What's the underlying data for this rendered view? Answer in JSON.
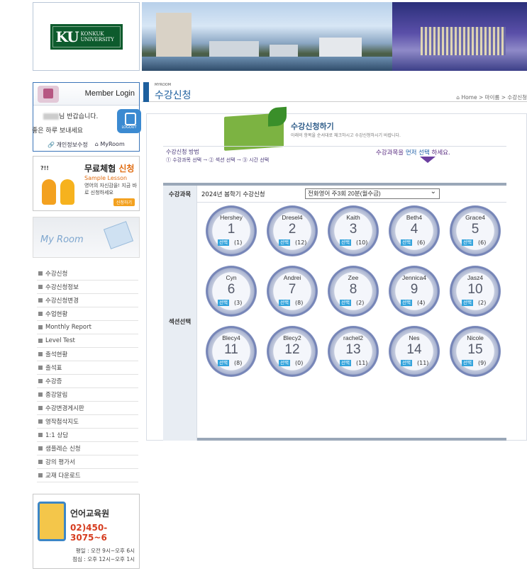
{
  "header": {
    "logo_mark": "KU",
    "logo_name_1": "KONKUK",
    "logo_name_2": "UNIVERSITY"
  },
  "login": {
    "title": "Member Login",
    "welcome_suffix": "님 반갑습니다.",
    "greeting": "좋은 하루 보내세요",
    "logout_label": "LOGOUT",
    "link_privacy": "개인정보수정",
    "link_myroom": "MyRoom"
  },
  "trial": {
    "title_plain": "무료체험",
    "title_highlight": "신청",
    "subtitle": "Sample Lesson",
    "desc": "영어의 자신감을! 지금 바로 신청하세요",
    "button": "신청하기",
    "badge": "?!!"
  },
  "myroom": {
    "title": "My Room"
  },
  "menu": [
    "수강신청",
    "수강신청정보",
    "수강신청변경",
    "수업현황",
    "Monthly Report",
    "Level Test",
    "출석현황",
    "출석표",
    "수강증",
    "종강알림",
    "수강변경게시판",
    "영작첨삭지도",
    "1:1 상담",
    "샘플레슨 신청",
    "강의 평가서",
    "교재 다운로드"
  ],
  "lang_center": {
    "title": "언어교육원",
    "phone": "02)450-3075~6",
    "hours_weekday": "평일 : 오전 9시~오후 6시",
    "hours_lunch": "점심 : 오후 12시~오후 1시"
  },
  "page": {
    "small_label": "MYROOM",
    "title": "수강신청",
    "breadcrumb": "⌂ Home > 마이룸 > 수강신청"
  },
  "enroll_header": {
    "title": "수강신청하기",
    "subtitle": "아래의 항목을 순서대로 체크하시고 수강신청하시기 바랍니다."
  },
  "howto": {
    "title": "수강신청 방법",
    "steps": "① 수강과목 선택 → ② 섹션 선택 → ③ 시간 선택",
    "notice_pre": "수강과목",
    "notice_mid": "을 ",
    "notice_blue": "먼저 선택",
    "notice_post": " 하세요."
  },
  "form": {
    "course_label": "수강과목",
    "course_text": "2024년 봄학기 수강신청",
    "course_selected": "전화영어 주3회 20분(월수금)",
    "section_label": "섹션선택"
  },
  "select_label": "선택",
  "tutors": [
    {
      "name": "Hershey",
      "num": "1",
      "count": "(1)"
    },
    {
      "name": "Dresel4",
      "num": "2",
      "count": "(12)"
    },
    {
      "name": "Kaith",
      "num": "3",
      "count": "(10)"
    },
    {
      "name": "Beth4",
      "num": "4",
      "count": "(6)"
    },
    {
      "name": "Grace4",
      "num": "5",
      "count": "(6)"
    },
    {
      "name": "Cyn",
      "num": "6",
      "count": "(3)"
    },
    {
      "name": "Andrei",
      "num": "7",
      "count": "(8)"
    },
    {
      "name": "Zee",
      "num": "8",
      "count": "(2)"
    },
    {
      "name": "Jennica4",
      "num": "9",
      "count": "(4)"
    },
    {
      "name": "Jasz4",
      "num": "10",
      "count": "(2)"
    },
    {
      "name": "Blecy4",
      "num": "11",
      "count": "(8)"
    },
    {
      "name": "Blecy2",
      "num": "12",
      "count": "(0)"
    },
    {
      "name": "rachel2",
      "num": "13",
      "count": "(11)"
    },
    {
      "name": "Nes",
      "num": "14",
      "count": "(11)"
    },
    {
      "name": "Nicole",
      "num": "15",
      "count": "(9)"
    }
  ]
}
